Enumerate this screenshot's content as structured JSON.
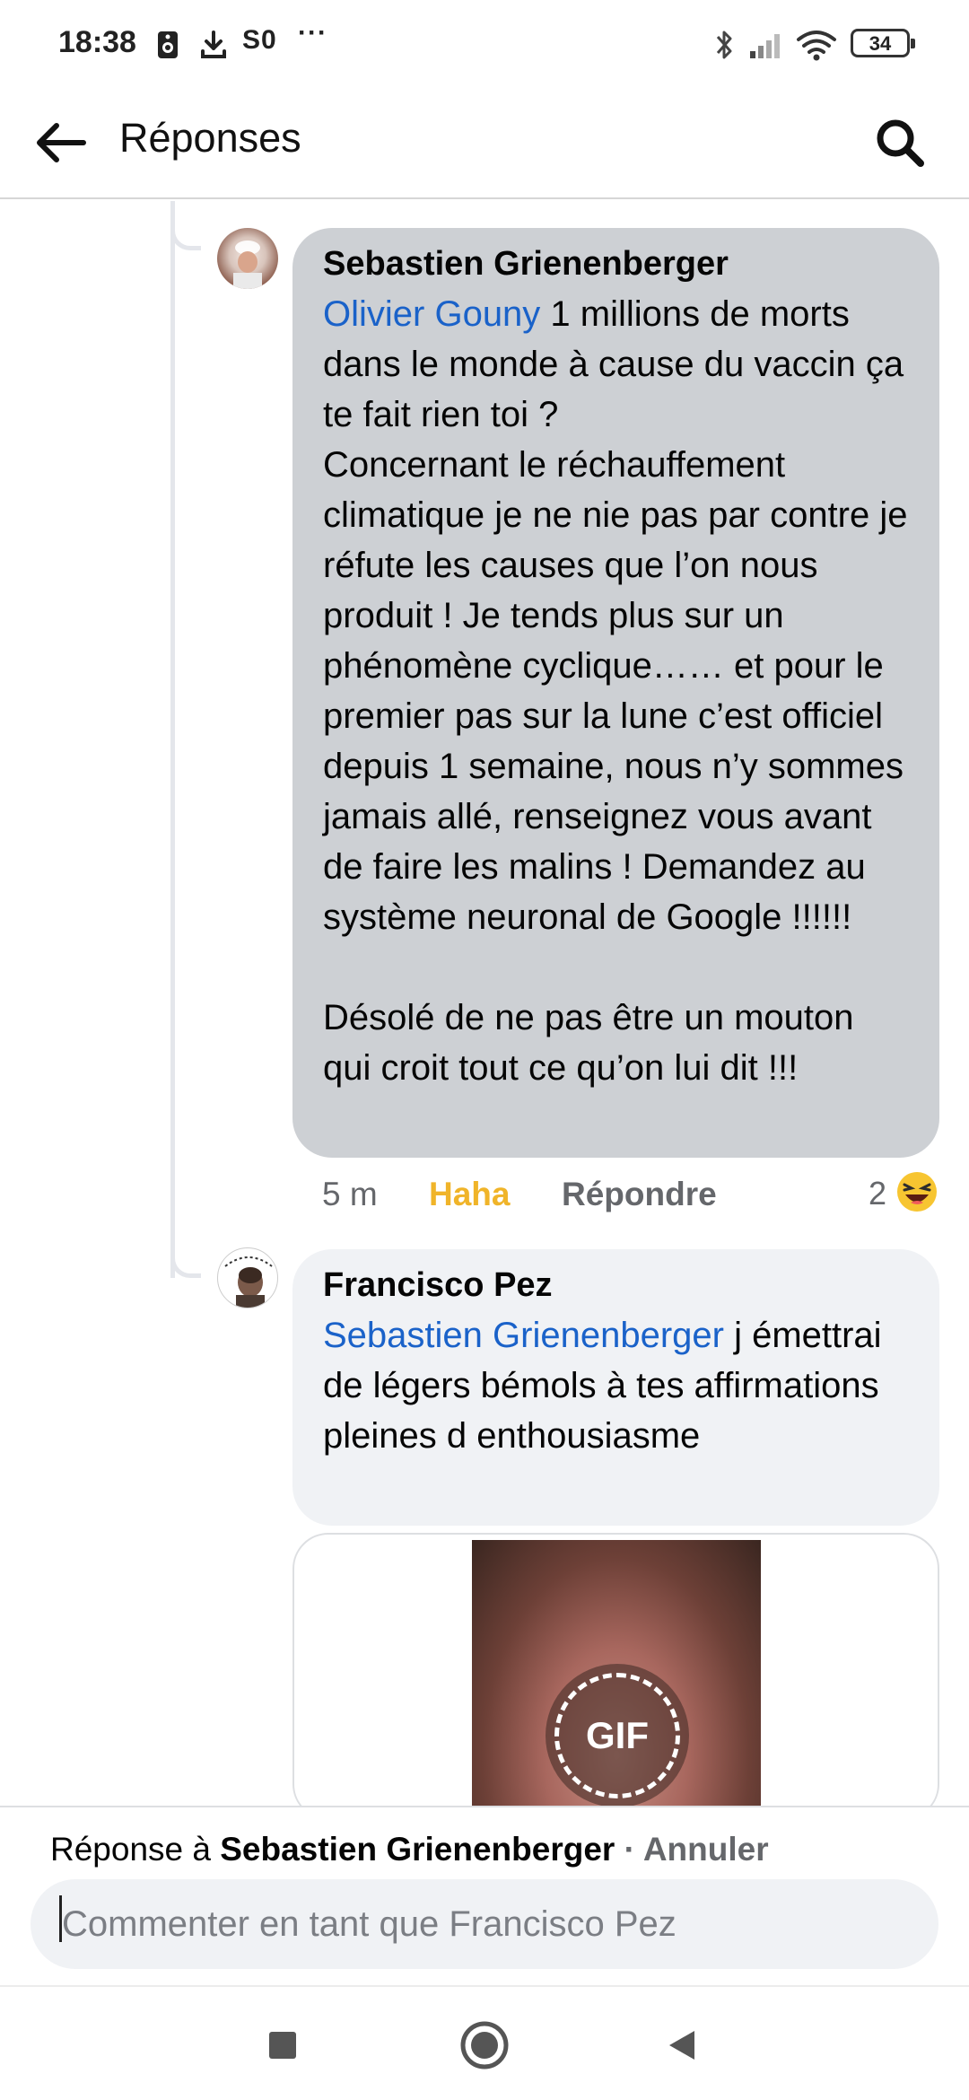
{
  "status_bar": {
    "time": "18:38",
    "so_text": "S0",
    "more_text": "···",
    "battery": "34",
    "icons": [
      "speaker-icon",
      "download-icon",
      "bluetooth-icon",
      "signal-icon",
      "wifi-icon",
      "battery-icon"
    ]
  },
  "header": {
    "title": "Réponses",
    "back_icon": "arrow-left-icon",
    "search_icon": "search-icon"
  },
  "comments": [
    {
      "author": "Sebastien Grienenberger",
      "mention": "Olivier Gouny",
      "text": " 1 millions de morts dans le monde à cause du vaccin ça te fait rien toi ?\nConcernant le réchauffement climatique je ne nie pas par contre je réfute les causes que l’on nous produit ! Je tends plus sur un phénomène cyclique…… et pour le premier pas sur la lune c’est officiel depuis 1 semaine, nous n’y sommes jamais allé, renseignez vous avant de faire les malins ! Demandez au système neuronal de Google !!!!!!\n\nDésolé de ne pas être un mouton qui croit tout ce qu’on lui dit !!!",
      "time": "5 m",
      "reaction_label": "Haha",
      "reply_label": "Répondre",
      "reaction_count": "2",
      "reaction_icon": "laughing-emoji-icon"
    },
    {
      "author": "Francisco Pez",
      "mention": "Sebastien Grienenberger",
      "text": " j émettrai de légers bémols à tes affirmations pleines d enthousiasme",
      "gif_label": "GIF"
    }
  ],
  "reply_bar": {
    "prefix": "Réponse à ",
    "target": "Sebastien Grienenberger",
    "separator": " · ",
    "cancel": "Annuler",
    "placeholder": "Commenter en tant que Francisco Pez"
  },
  "nav_bar": {
    "icons": [
      "recent-apps-icon",
      "home-icon",
      "back-triangle-icon"
    ]
  },
  "colors": {
    "mention": "#1a62c9",
    "haha": "#f0b429",
    "bubble_gray": "#cdd0d4",
    "bubble_light": "#f0f2f5"
  }
}
